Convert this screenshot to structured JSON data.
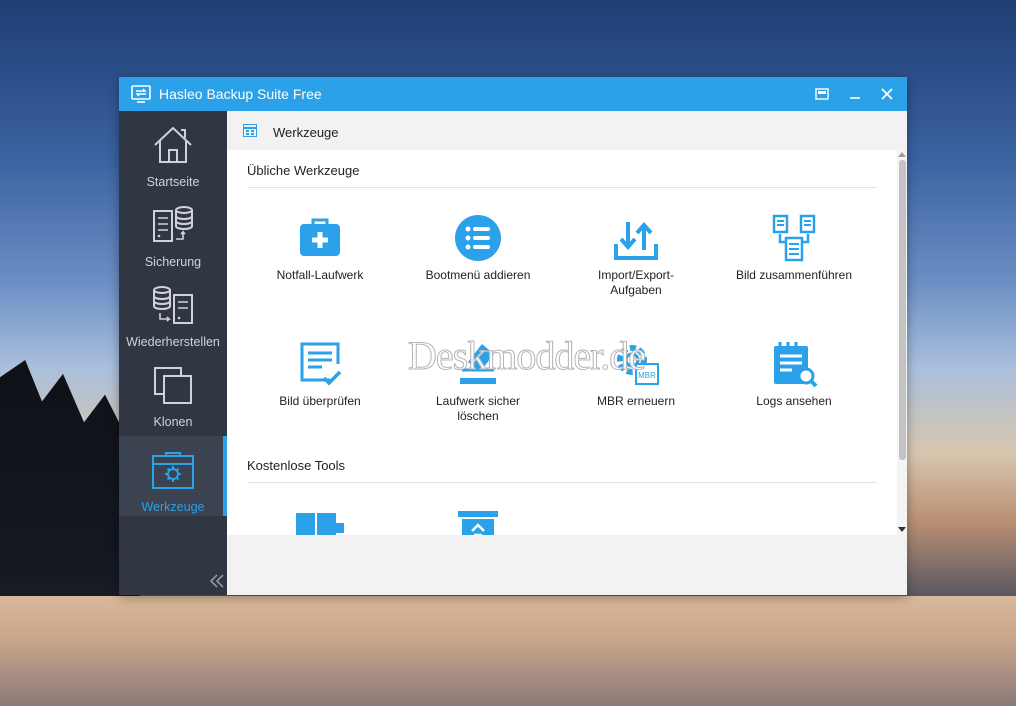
{
  "window": {
    "title": "Hasleo Backup Suite Free"
  },
  "sidebar": {
    "items": [
      {
        "label": "Startseite",
        "icon": "house-icon"
      },
      {
        "label": "Sicherung",
        "icon": "database-backup-icon"
      },
      {
        "label": "Wiederherstellen",
        "icon": "database-restore-icon"
      },
      {
        "label": "Klonen",
        "icon": "clone-icon"
      },
      {
        "label": "Werkzeuge",
        "icon": "toolbox-icon",
        "active": true
      }
    ]
  },
  "header": {
    "title": "Werkzeuge"
  },
  "sections": {
    "common": {
      "title": "Übliche Werkzeuge",
      "tools": [
        {
          "label": "Notfall-Laufwerk",
          "icon": "medical-kit-icon"
        },
        {
          "label": "Bootmenü addieren",
          "icon": "list-icon"
        },
        {
          "label": "Import/Export-Aufgaben",
          "icon": "import-export-icon"
        },
        {
          "label": "Bild zusammenführen",
          "icon": "merge-image-icon"
        },
        {
          "label": "Bild überprüfen",
          "icon": "check-document-icon"
        },
        {
          "label": "Laufwerk sicher löschen",
          "icon": "erase-drive-icon"
        },
        {
          "label": "MBR erneuern",
          "icon": "mbr-gear-icon"
        },
        {
          "label": "Logs ansehen",
          "icon": "log-search-icon"
        }
      ]
    },
    "free": {
      "title": "Kostenlose Tools",
      "tools": [
        {
          "label": "",
          "icon": "drive-tool-icon"
        },
        {
          "label": "",
          "icon": "recycle-bin-icon"
        }
      ]
    }
  },
  "watermark": "Deskmodder.de",
  "colors": {
    "accent": "#2aa1e8",
    "sidebar": "#303743"
  }
}
